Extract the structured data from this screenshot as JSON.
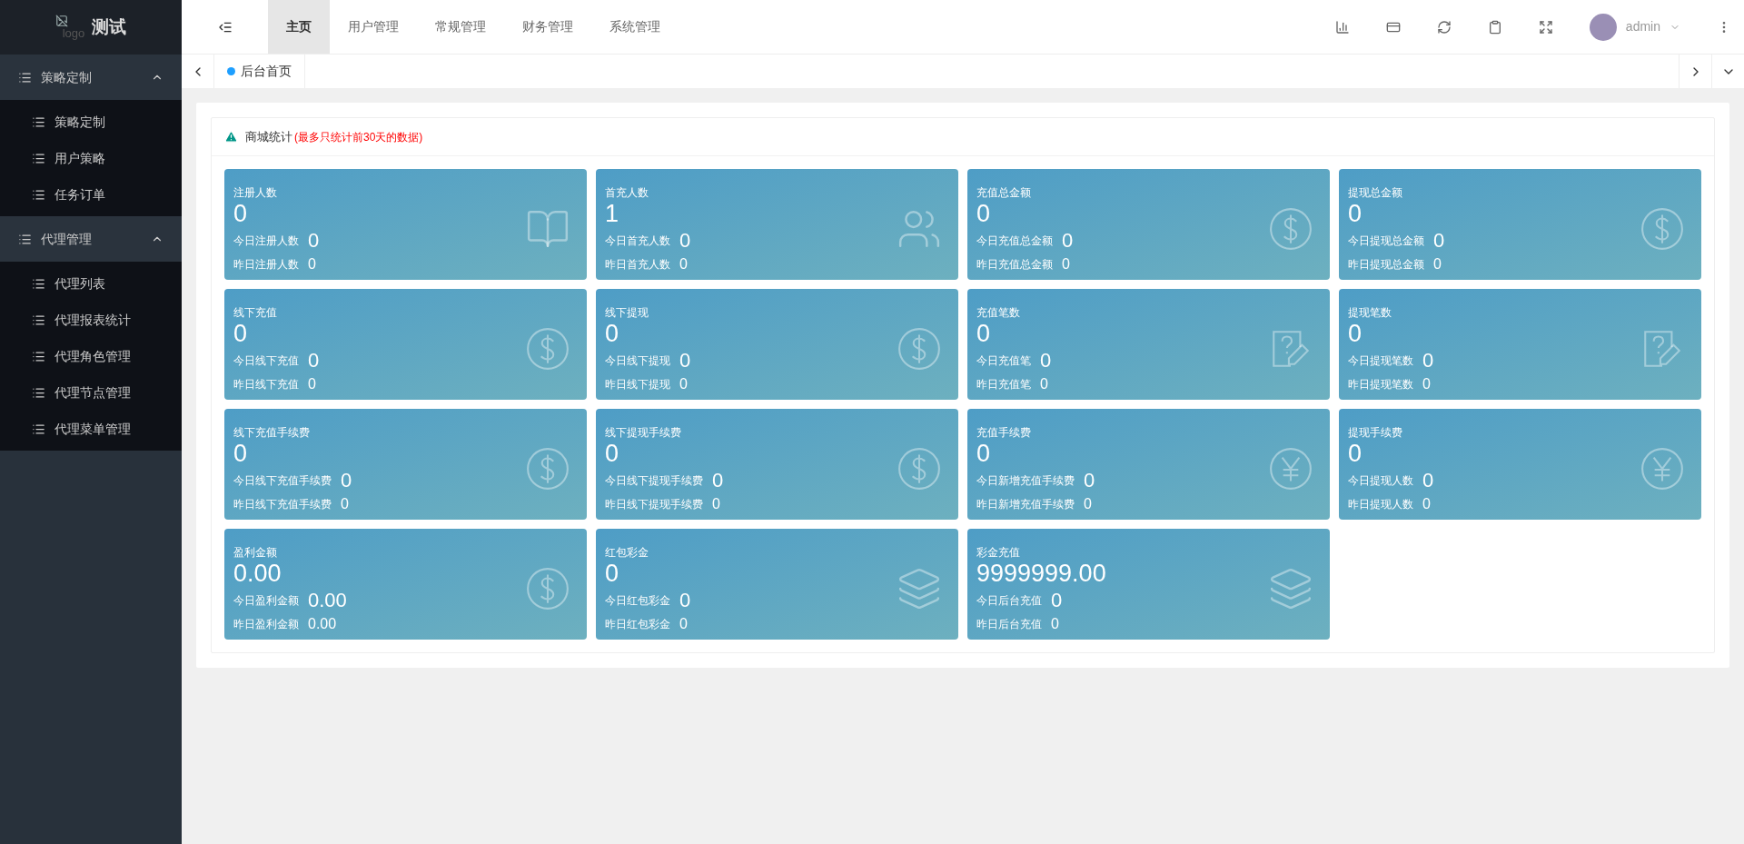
{
  "logo": {
    "alt": "logo",
    "title": "测试"
  },
  "top_nav": [
    {
      "label": "主页",
      "selected": true
    },
    {
      "label": "用户管理",
      "selected": false
    },
    {
      "label": "常规管理",
      "selected": false
    },
    {
      "label": "财务管理",
      "selected": false
    },
    {
      "label": "系统管理",
      "selected": false
    }
  ],
  "user": {
    "name": "admin"
  },
  "sidebar": [
    {
      "label": "策略定制",
      "expanded": true,
      "children": [
        {
          "label": "策略定制"
        },
        {
          "label": "用户策略"
        },
        {
          "label": "任务订单"
        }
      ]
    },
    {
      "label": "代理管理",
      "expanded": true,
      "children": [
        {
          "label": "代理列表"
        },
        {
          "label": "代理报表统计"
        },
        {
          "label": "代理角色管理"
        },
        {
          "label": "代理节点管理"
        },
        {
          "label": "代理菜单管理"
        }
      ]
    }
  ],
  "page_tabs": [
    {
      "label": "后台首页",
      "selected": true
    }
  ],
  "panel": {
    "title": "商城统计",
    "note": "(最多只统计前30天的数据)"
  },
  "cards": [
    {
      "title": "注册人数",
      "value": "0",
      "today_label": "今日注册人数",
      "today_value": "0",
      "yesterday_label": "昨日注册人数",
      "yesterday_value": "0",
      "kind": "book"
    },
    {
      "title": "首充人数",
      "value": "1",
      "today_label": "今日首充人数",
      "today_value": "0",
      "yesterday_label": "昨日首充人数",
      "yesterday_value": "0",
      "kind": "users"
    },
    {
      "title": "充值总金额",
      "value": "0",
      "today_label": "今日充值总金额",
      "today_value": "0",
      "yesterday_label": "昨日充值总金额",
      "yesterday_value": "0",
      "kind": "dollar"
    },
    {
      "title": "提现总金额",
      "value": "0",
      "today_label": "今日提现总金额",
      "today_value": "0",
      "yesterday_label": "昨日提现总金额",
      "yesterday_value": "0",
      "kind": "dollar"
    },
    {
      "title": "线下充值",
      "value": "0",
      "today_label": "今日线下充值",
      "today_value": "0",
      "yesterday_label": "昨日线下充值",
      "yesterday_value": "0",
      "kind": "dollar"
    },
    {
      "title": "线下提现",
      "value": "0",
      "today_label": "今日线下提现",
      "today_value": "0",
      "yesterday_label": "昨日线下提现",
      "yesterday_value": "0",
      "kind": "dollar"
    },
    {
      "title": "充值笔数",
      "value": "0",
      "today_label": "今日充值笔",
      "today_value": "0",
      "yesterday_label": "昨日充值笔",
      "yesterday_value": "0",
      "kind": "note"
    },
    {
      "title": "提现笔数",
      "value": "0",
      "today_label": "今日提现笔数",
      "today_value": "0",
      "yesterday_label": "昨日提现笔数",
      "yesterday_value": "0",
      "kind": "note"
    },
    {
      "title": "线下充值手续费",
      "value": "0",
      "today_label": "今日线下充值手续费",
      "today_value": "0",
      "yesterday_label": "昨日线下充值手续费",
      "yesterday_value": "0",
      "kind": "dollar"
    },
    {
      "title": "线下提现手续费",
      "value": "0",
      "today_label": "今日线下提现手续费",
      "today_value": "0",
      "yesterday_label": "昨日线下提现手续费",
      "yesterday_value": "0",
      "kind": "dollar"
    },
    {
      "title": "充值手续费",
      "value": "0",
      "today_label": "今日新增充值手续费",
      "today_value": "0",
      "yesterday_label": "昨日新增充值手续费",
      "yesterday_value": "0",
      "kind": "yen"
    },
    {
      "title": "提现手续费",
      "value": "0",
      "today_label": "今日提现人数",
      "today_value": "0",
      "yesterday_label": "昨日提现人数",
      "yesterday_value": "0",
      "kind": "yen"
    },
    {
      "title": "盈利金额",
      "value": "0.00",
      "today_label": "今日盈利金额",
      "today_value": "0.00",
      "yesterday_label": "昨日盈利金额",
      "yesterday_value": "0.00",
      "kind": "dollar"
    },
    {
      "title": "红包彩金",
      "value": "0",
      "today_label": "今日红包彩金",
      "today_value": "0",
      "yesterday_label": "昨日红包彩金",
      "yesterday_value": "0",
      "kind": "layers"
    },
    {
      "title": "彩金充值",
      "value": "9999999.00",
      "today_label": "今日后台充值",
      "today_value": "0",
      "yesterday_label": "昨日后台充值",
      "yesterday_value": "0",
      "kind": "layers"
    }
  ]
}
